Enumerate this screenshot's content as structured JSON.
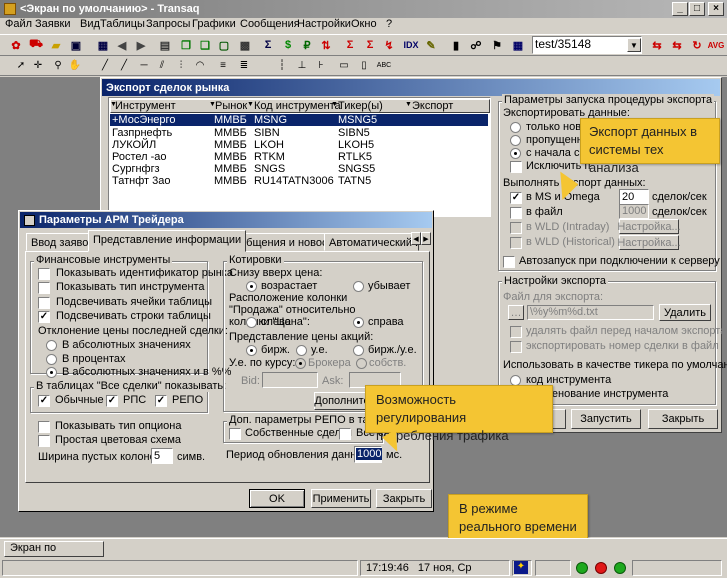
{
  "app": {
    "title": "<Экран по умолчанию> - Transaq",
    "menu": [
      "Файл",
      "Заявки",
      "Вид",
      "Таблицы",
      "Запросы",
      "Графики",
      "Сообщения",
      "Настройки",
      "Окно",
      "?"
    ],
    "toolbar_combo": "test/35148"
  },
  "export_window": {
    "title": "Экспорт сделок рынка",
    "columns": [
      "Инструмент",
      "Рынок",
      "Код инструмента",
      "Тикер(ы)",
      "Экспорт"
    ],
    "rows": [
      {
        "name": "+МосЭнерго",
        "market": "ММВБ",
        "code": "MSNG",
        "ticker": "MSNG5"
      },
      {
        "name": "Газпрнефть",
        "market": "ММВБ",
        "code": "SIBN",
        "ticker": "SIBN5"
      },
      {
        "name": "ЛУКОЙЛ",
        "market": "ММВБ",
        "code": "LKOH",
        "ticker": "LKOH5"
      },
      {
        "name": "Ростел -ао",
        "market": "ММВБ",
        "code": "RTKM",
        "ticker": "RTLK5"
      },
      {
        "name": "Сургнфгз",
        "market": "ММВБ",
        "code": "SNGS",
        "ticker": "SNGS5"
      },
      {
        "name": "Татнфт 3ао",
        "market": "ММВБ",
        "code": "RU14TATN3006",
        "ticker": "TATN5"
      }
    ],
    "params_group": "Параметры запуска процедуры экспорта",
    "export_data_label": "Экспортировать данные:",
    "opt_new_only": "только новые",
    "opt_missed": "пропущенные",
    "opt_session_start": "с начала сессии",
    "exclude_label": "Исключить п",
    "run_export_label": "Выполнять экспорт данных:",
    "in_ms_omega": "в MS и Omega",
    "ms_value": "20",
    "per_sec1": "сделок/сек",
    "in_file": "в файл",
    "file_value": "1000",
    "per_sec2": "сделок/сек",
    "in_wld_intraday": "в WLD (Intraday)",
    "in_wld_historical": "в WLD (Historical)",
    "settings_btn": "Настройка...",
    "autostart": "Автозапуск при подключении к серверу",
    "export_settings_group": "Настройки экспорта",
    "file_for_export": "Файл для экспорта:",
    "file_path": "\\%y%m%d.txt",
    "delete_btn": "Удалить",
    "delete_file_before": "удалять файл перед началом экспорта",
    "export_deal_number": "экспортировать номер сделки в файл",
    "use_as_ticker": "Использовать в качестве тикера по умолчанию:",
    "instr_code": "код инструмента",
    "instr_name": "наименование инструмента",
    "start_btn": "Запустить",
    "close_btn": "Закрыть"
  },
  "trader_window": {
    "title": "Параметры АРМ Трейдера",
    "tabs": [
      "Ввод заявок",
      "Представление информации",
      "Сообщения и новости",
      "Автоматический ие"
    ],
    "fin_instr_group": "Финансовые инструменты",
    "show_instr_id": "Показывать идентификатор рынка",
    "show_instr_type": "Показывать тип инструмента",
    "highlight_cells": "Подсвечивать ячейки таблицы",
    "highlight_rows": "Подсвечивать строки таблицы",
    "last_deal_dev": "Отклонение цены последней сделки:",
    "abs_values": "В абсолютных значениях",
    "percents": "В процентах",
    "abs_and_pct": "В абсолютных значениях и в %%",
    "all_deals_show": "В таблицах \"Все сделки\" показывать:",
    "ordinary": "Обычные",
    "rps": "РПС",
    "repo": "РЕПО",
    "show_option_type": "Показывать тип опциона",
    "simple_color": "Простая цветовая схема",
    "empty_cols_width": "Ширина пустых колонок:",
    "empty_cols_value": "5",
    "symbols": "симв.",
    "quotes_group": "Котировки",
    "top_down_price": "Снизу вверх цена:",
    "ascending": "возрастает",
    "descending": "убывает",
    "sell_column_pos": "Расположение колонки \"Продажа\" относительно колонки \"Цена\":",
    "left": "слева",
    "right": "справа",
    "price_repr": "Представление цены акций:",
    "birzh": "бирж.",
    "ue": "у.е.",
    "birzh_ue": "бирж./у.е.",
    "ue_rate": "У.е. по курсу:",
    "broker": "Брокера",
    "own": "собств.",
    "bid": "Bid:",
    "ask": "Ask:",
    "more_btn": "Дополните",
    "repo_params": "Доп. параметры РЕПО в таблица",
    "own_deals": "Собственные сделки",
    "all_deals": "Все сде",
    "update_period": "Период обновления данных:",
    "update_value": "1000",
    "ms": "мс.",
    "ok_btn": "OK",
    "apply_btn": "Применить",
    "close_btn": "Закрыть"
  },
  "callouts": {
    "export_to_ta": "Экспорт данных в системы тех анализа",
    "traffic": "Возможность регулирования потребления трафика",
    "realtime": "В режиме реального времени"
  },
  "statusbar": {
    "tab_default": "Экран по умолчанию",
    "time": "17:19:46",
    "date": "17 ноя, Ср"
  }
}
